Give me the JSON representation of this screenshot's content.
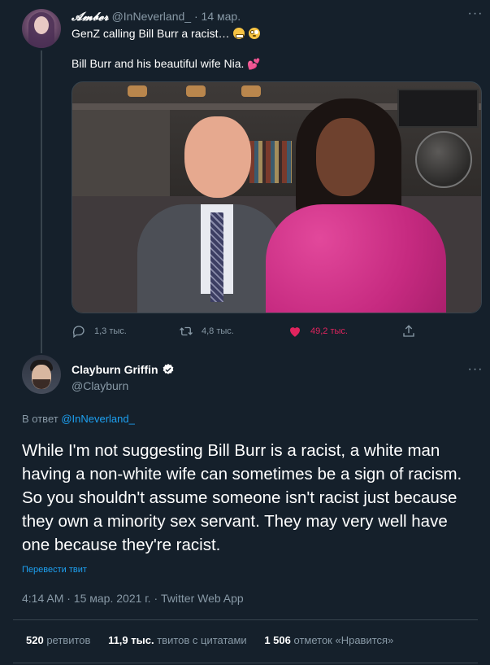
{
  "parent_tweet": {
    "display_name": "𝓐𝓶𝓫𝓮𝓻",
    "handle": "@InNeverland_",
    "separator": "·",
    "date": "14 мар.",
    "text_line1": "GenZ calling Bill Burr a racist…",
    "text_line2": "Bill Burr and his beautiful wife Nia.",
    "more": "···",
    "actions": {
      "replies": "1,3 тыс.",
      "retweets": "4,8 тыс.",
      "likes": "49,2 тыс."
    },
    "colors": {
      "like": "#e0245e"
    }
  },
  "main_tweet": {
    "display_name": "Clayburn Griffin",
    "handle": "@Clayburn",
    "more": "···",
    "reply_prefix": "В ответ",
    "reply_to": "@InNeverland_",
    "body": "While I'm not suggesting Bill Burr is a racist, a white man having a non-white wife can sometimes be a sign of racism.  So you shouldn't assume someone isn't racist just because they own a minority sex servant. They may very well have one because they're racist.",
    "translate": "Перевести твит",
    "meta": "4:14 AM · 15 мар. 2021 г. · Twitter Web App",
    "stats": {
      "retweets_count": "520",
      "retweets_label": "ретвитов",
      "quotes_count": "11,9 тыс.",
      "quotes_label": "твитов с цитатами",
      "likes_count": "1 506",
      "likes_label": "отметок «Нравится»"
    }
  },
  "icons": [
    "reply-icon",
    "retweet-icon",
    "like-icon",
    "share-icon",
    "verified-icon",
    "more-icon"
  ],
  "colors": {
    "background": "#15202b",
    "secondary_text": "#8899a6",
    "link": "#1da1f2",
    "border": "#38444d"
  }
}
